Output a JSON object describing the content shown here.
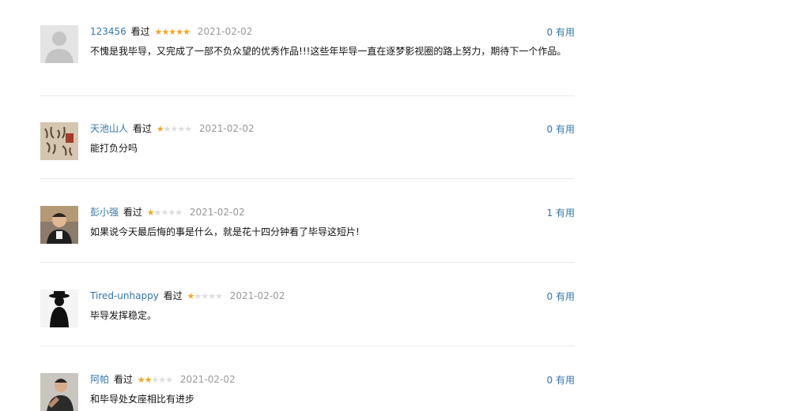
{
  "comments": [
    {
      "user": "123456",
      "status": "看过",
      "rating": 5,
      "time": "2021-02-02",
      "votes": "0",
      "useful_label": "有用",
      "text": "不愧是我毕导，又完成了一部不负众望的优秀作品!!!这些年毕导一直在逐梦影视圈的路上努力，期待下一个作品。",
      "avatar_icon": "default-user-icon"
    },
    {
      "user": "天池山人",
      "status": "看过",
      "rating": 1,
      "time": "2021-02-02",
      "votes": "0",
      "useful_label": "有用",
      "text": "能打负分吗",
      "avatar_icon": "calligraphy-avatar"
    },
    {
      "user": "彭小强",
      "status": "看过",
      "rating": 1,
      "time": "2021-02-02",
      "votes": "1",
      "useful_label": "有用",
      "text": "如果说今天最后悔的事是什么，就是花十四分钟看了毕导这短片!",
      "avatar_icon": "photo-avatar"
    },
    {
      "user": "Tired-unhappy",
      "status": "看过",
      "rating": 1,
      "time": "2021-02-02",
      "votes": "0",
      "useful_label": "有用",
      "text": "毕导发挥稳定。",
      "avatar_icon": "silhouette-hat-avatar"
    },
    {
      "user": "阿帕",
      "status": "看过",
      "rating": 2,
      "time": "2021-02-02",
      "votes": "0",
      "useful_label": "有用",
      "text": "和毕导处女座相比有进步",
      "avatar_icon": "photo-avatar"
    }
  ],
  "colors": {
    "link": "#3377aa",
    "star_on": "#f5a623",
    "star_off": "#dddddd",
    "meta_gray": "#999999"
  }
}
